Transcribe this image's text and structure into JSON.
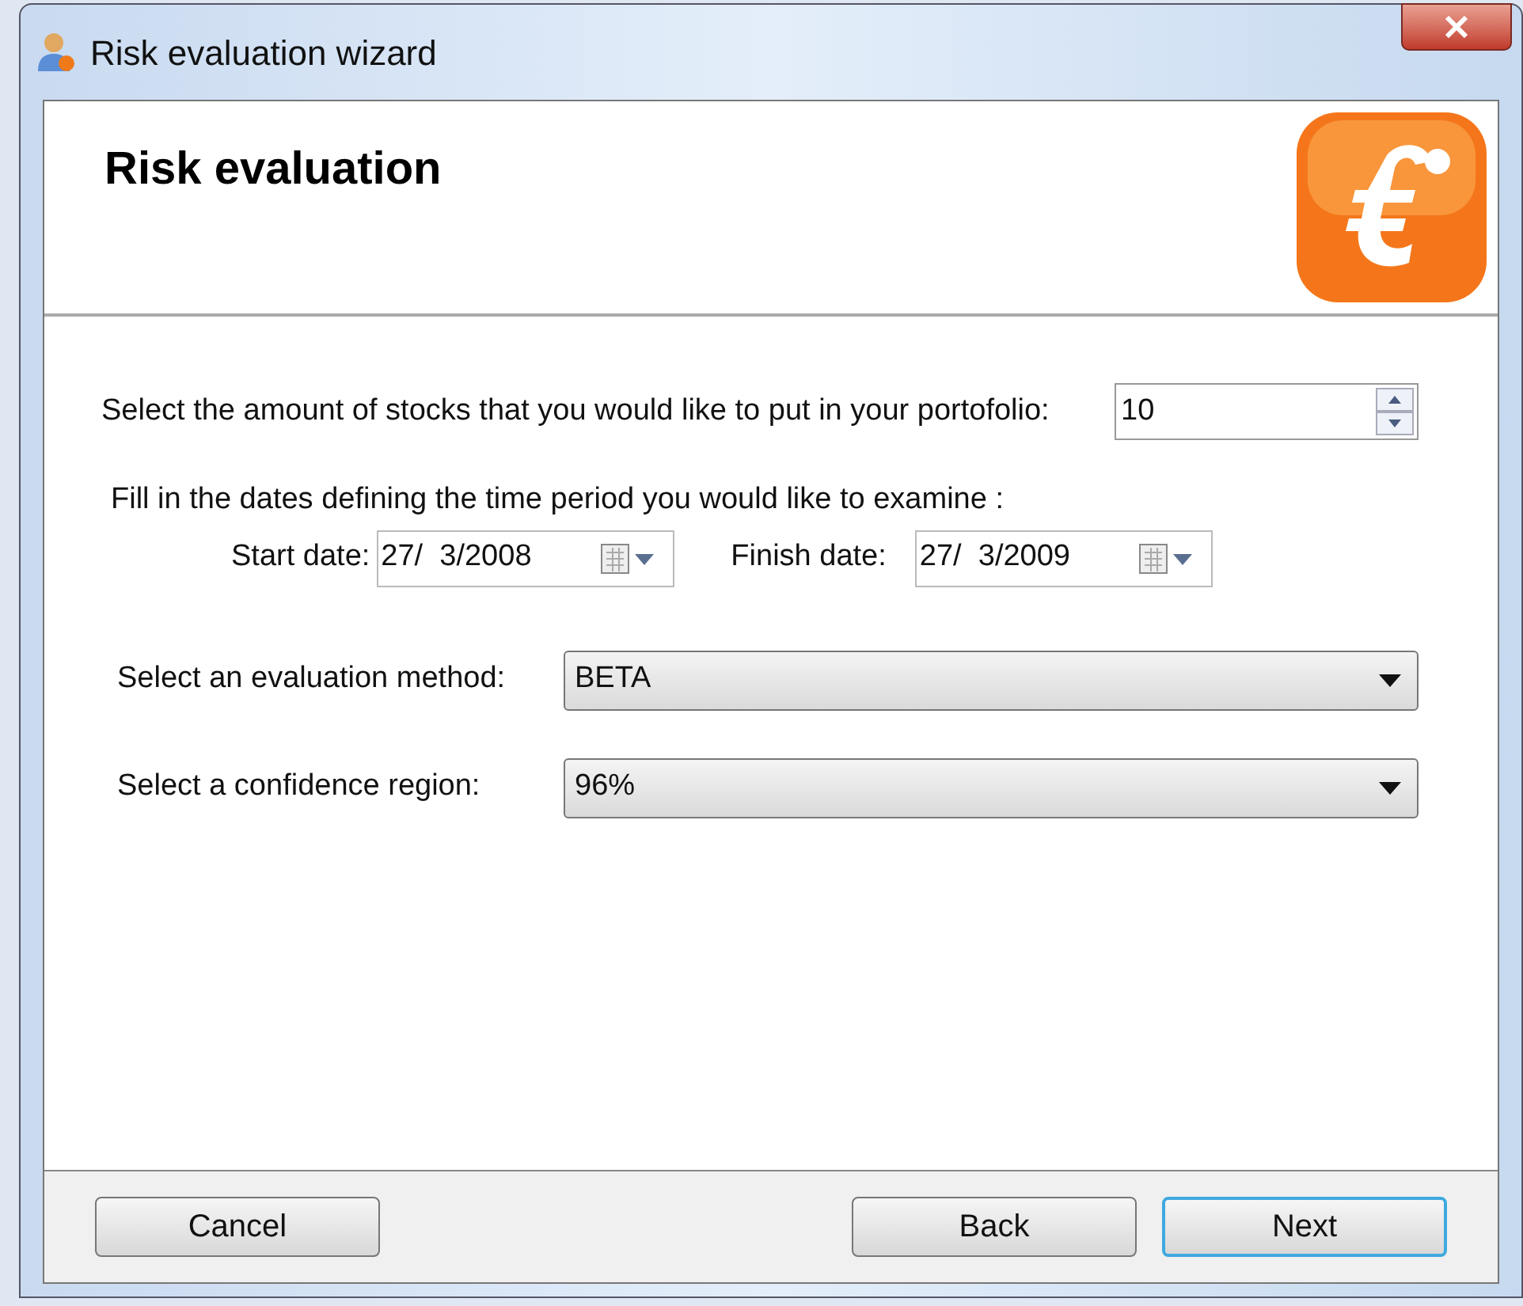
{
  "window": {
    "title": "Risk evaluation wizard"
  },
  "header": {
    "title": "Risk evaluation"
  },
  "stocks": {
    "label": "Select the amount of stocks that you would like to put in your portofolio:",
    "value": "10"
  },
  "dates": {
    "label": "Fill in the dates defining the time period you would like to examine :",
    "fields": [
      {
        "label": "Start date:",
        "value": "27/  3/2008"
      },
      {
        "label": "Finish date:",
        "value": "27/  3/2009"
      }
    ]
  },
  "selects": [
    {
      "label": "Select an evaluation method:",
      "value": "BETA"
    },
    {
      "label": "Select a confidence region:",
      "value": "96%"
    }
  ],
  "buttons": [
    {
      "label": "Cancel",
      "default": false
    },
    {
      "label": "Back",
      "default": false
    },
    {
      "label": "Next",
      "default": true
    }
  ]
}
